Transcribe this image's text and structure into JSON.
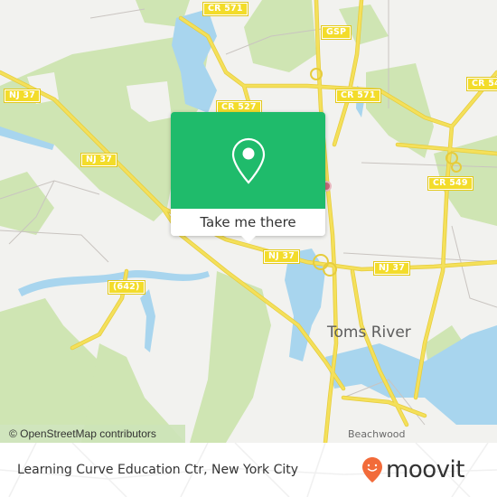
{
  "map": {
    "attribution": "© OpenStreetMap contributors",
    "route_shields": [
      {
        "id": "cr571-top",
        "label": "CR 571"
      },
      {
        "id": "gsp",
        "label": "GSP"
      },
      {
        "id": "cr571-mid",
        "label": "CR 571"
      },
      {
        "id": "cr54-right",
        "label": "CR 54"
      },
      {
        "id": "cr527",
        "label": "CR 527"
      },
      {
        "id": "nj37-left",
        "label": "NJ 37"
      },
      {
        "id": "nj37-mid-left",
        "label": "NJ 37"
      },
      {
        "id": "cr549",
        "label": "CR 549"
      },
      {
        "id": "nj37-center",
        "label": "NJ 37"
      },
      {
        "id": "nj37-right",
        "label": "NJ 37"
      },
      {
        "id": "cr642",
        "label": "(642)"
      }
    ],
    "places": [
      {
        "id": "toms-river",
        "label": "Toms River"
      },
      {
        "id": "beachwood",
        "label": "Beachwood"
      }
    ],
    "colors": {
      "land": "#f2f2ef",
      "park": "#cfe5b3",
      "water": "#a8d5ee",
      "road": "#f4e05a",
      "minor_road": "#c9c4c0"
    }
  },
  "popup": {
    "action_label": "Take me there",
    "icon": "map-pin-icon",
    "accent_color": "#1fbb6b"
  },
  "footer": {
    "title": "Learning Curve Education Ctr, New York City",
    "brand": "moovit",
    "brand_color": "#f26b3a"
  }
}
